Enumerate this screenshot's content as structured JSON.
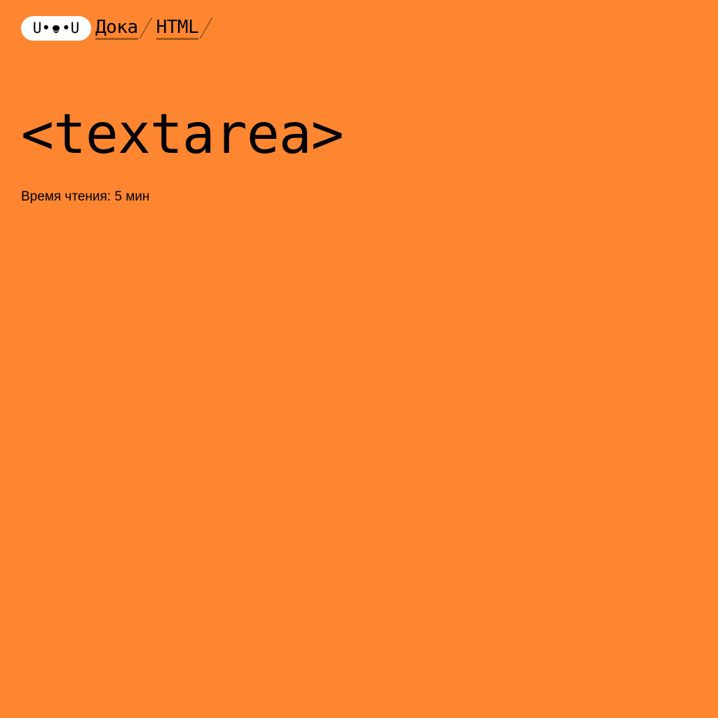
{
  "header": {
    "logo": {
      "left": "U•",
      "right": "•U",
      "icon": "doka-logo-icon"
    },
    "breadcrumbs": [
      {
        "label": "Дока"
      },
      {
        "label": "HTML"
      }
    ]
  },
  "article": {
    "title": "<textarea>",
    "reading_time": "Время чтения: 5 мин"
  },
  "colors": {
    "background": "#ff8630",
    "logo_background": "#ffffff",
    "breadcrumb_underline": "#a35617",
    "text": "#000000"
  }
}
